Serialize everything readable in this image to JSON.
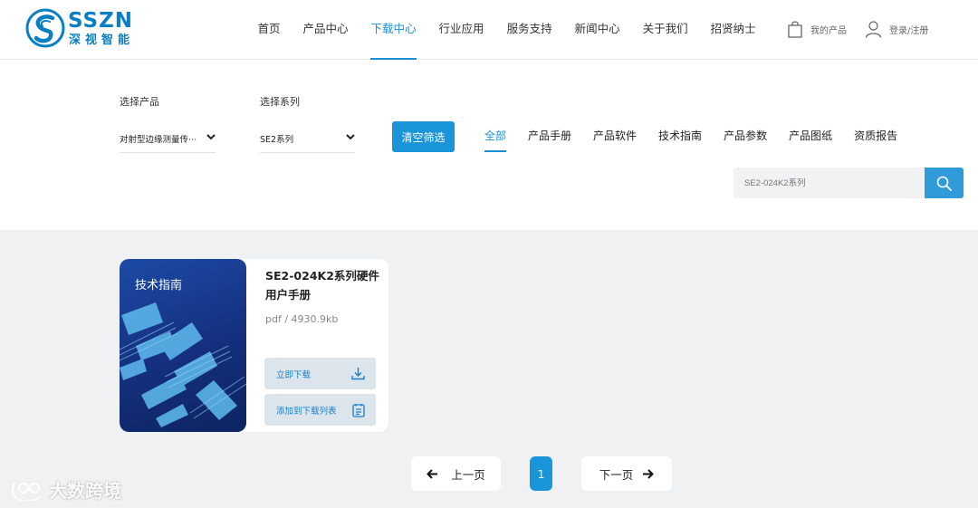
{
  "header": {
    "logo_en": "SSZN",
    "logo_cn": "深视智能",
    "nav": [
      "首页",
      "产品中心",
      "下载中心",
      "行业应用",
      "服务支持",
      "新闻中心",
      "关于我们",
      "招贤纳士"
    ],
    "active_nav": "下载中心",
    "cart_label": "我的产品",
    "login_label": "登录/注册"
  },
  "filter": {
    "product_label": "选择产品",
    "product_value": "对射型边缘测量传⋯",
    "series_label": "选择系列",
    "series_value": "SE2系列",
    "clear_button": "清空筛选",
    "tabs": [
      "全部",
      "产品手册",
      "产品软件",
      "技术指南",
      "产品参数",
      "产品图纸",
      "资质报告"
    ],
    "active_tab": "全部",
    "search_placeholder": "SE2-024K2系列"
  },
  "results": [
    {
      "category": "技术指南",
      "title": "SE2-024K2系列硬件用户手册",
      "meta": "pdf / 4930.9kb",
      "download_label": "立即下载",
      "add_label": "添加到下载列表"
    }
  ],
  "pagination": {
    "prev": "上一页",
    "current": "1",
    "next": "下一页"
  },
  "watermark": "大数跨境",
  "colors": {
    "accent": "#1a95d9",
    "brand": "#0a7fc3",
    "content_bg": "#f0f1f2",
    "card_image": "#142f7d"
  }
}
